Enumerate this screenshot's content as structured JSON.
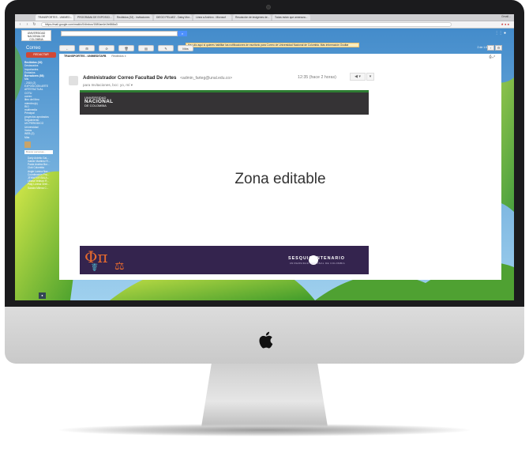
{
  "browser": {
    "tabs": [
      "TRANSPORTES - UNIMED...",
      "PROGRAMA DE EXPOSICI...",
      "Recibidos (32) - invitaciones",
      "DIEGO PELAEZ - Daisy Mor...",
      "Linea a Archivo - Microsof",
      "Resolución de imágenes de...",
      "Todas están que amenaza..."
    ],
    "url": "https://mail.google.com/mail/u/0/#inbox/1580ae4e1fe866a3",
    "tab_corner": "Gmail..."
  },
  "gmail": {
    "logo_text": "UNIVERSIDAD NACIONAL DE COLOMBIA",
    "title": "Correo",
    "banner": "Haz clic aquí si quieres habilitar las notificaciones de escritorio para Correo de Universidad Nacional de Colombia.   Más información   Ocultar",
    "pager": "2 de 1.004",
    "toolbar": [
      "←",
      "⊞",
      "⊘",
      "🗑",
      "▤",
      "✎",
      "Más"
    ],
    "compose": "REDACTAR",
    "sidebar": [
      "Recibidos (32)",
      "Destacados",
      "Importantes",
      "Enviados",
      "Borradores (58)",
      "Mis",
      "- 2015 (2)",
      "  EXPOSICIÓN ARTE",
      "  ARTEFACTUAL",
      "  COTU",
      "  correo",
      "  libro del libro",
      "  miembro(s)",
      "  RIO",
      "  multimedia",
      "  Principal",
      "  proyectos aprobados",
      "  Seguimiento",
      "  UN PERIODICO",
      "  Universidad",
      "  Varios",
      "  WEB (2)",
      "  Más"
    ],
    "chat_search": "Buscar personas...",
    "contacts": [
      "Darly Ardeito Gal...",
      "Gabier Martinez R...",
      "Paula Andrea Bur...",
      "Club Colombia",
      "Angie Lorena Nav...",
      "Coordinación Pro...",
      "JENNIFER BALA...",
      "Liliana Velasco R...",
      "Paty Lorena Orell...",
      "Sandra Milena C..."
    ]
  },
  "email": {
    "breadcrumb": "TRANSPORTES - UNIMEDITAFB",
    "label": "Recibidos x",
    "sender_name": "Administrador Correo Facultad De Artes",
    "sender_email": "<admin_farteg@unal.edu.co>",
    "to_line": "para Invitaciones, bcc: yo, mí ▾",
    "time": "12:35 (hace 2 horas)",
    "reply": "◀ ▾",
    "more": "▾",
    "header_logo_small": "UNIVERSIDAD",
    "header_logo_big": "NACIONAL",
    "header_logo_sub": "DE COLOMBIA",
    "body": "Zona editable",
    "footer_title": "SESQUICENTENARIO",
    "footer_subtitle": "UNIVERSIDAD NACIONAL DE COLOMBIA",
    "footer_glyph_pi": "Φπ",
    "footer_glyph_b": "☤",
    "footer_glyph_c": "⚖"
  },
  "colors": {
    "compose": "#d14836",
    "mail_header_bg": "#353335",
    "footer_bg": "#34244e",
    "accent_green": "#2e7d32"
  }
}
